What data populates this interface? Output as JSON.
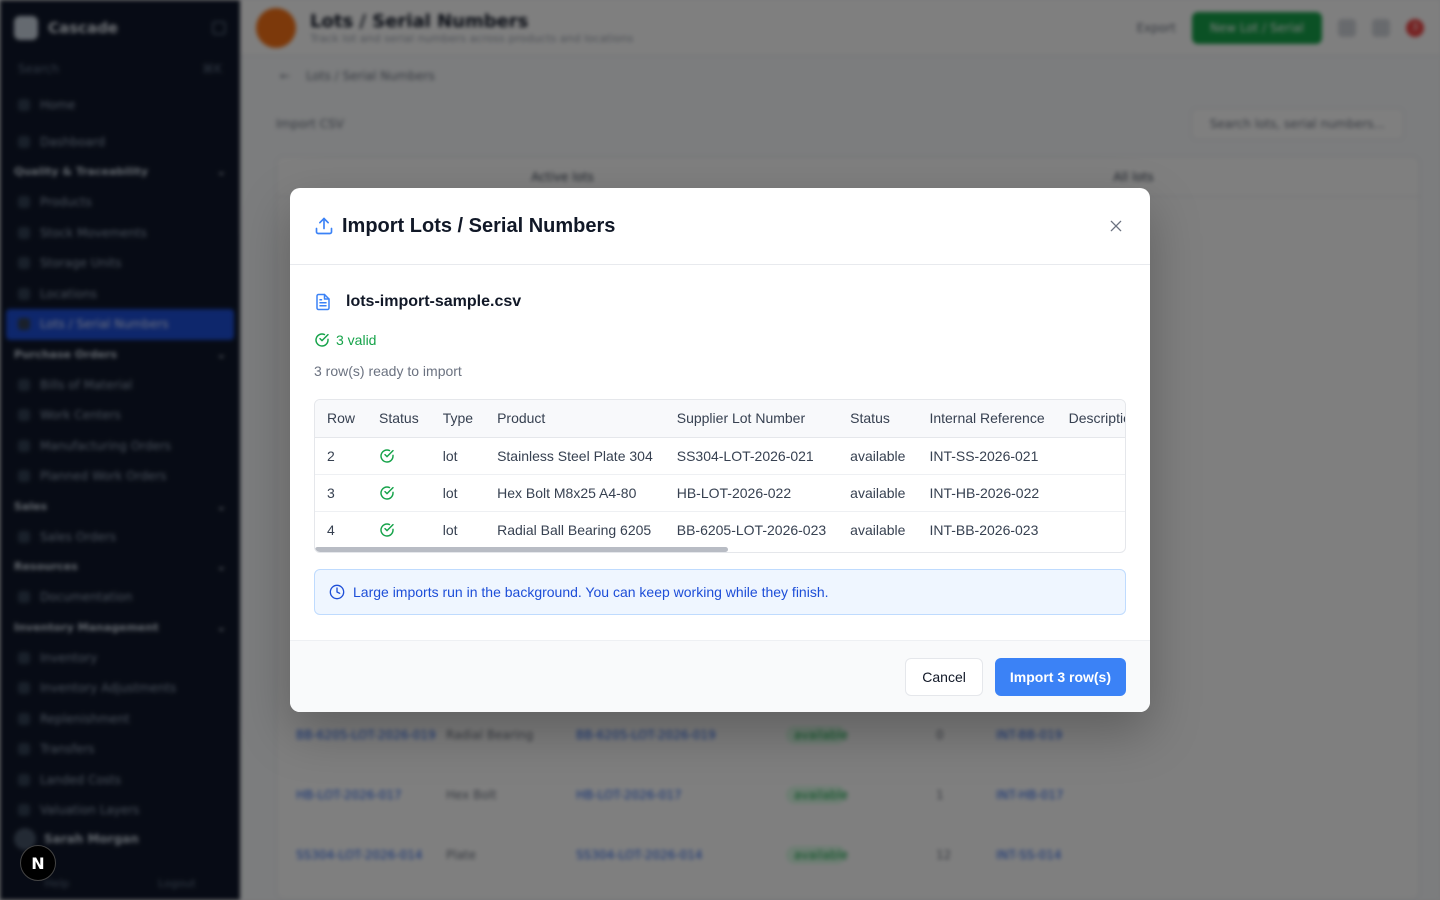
{
  "background": {
    "sidebar": {
      "app_name": "Cascade",
      "search_label": "Search",
      "search_shortcut": "⌘K",
      "top_item": "Home",
      "items": [
        {
          "type": "item",
          "label": "Dashboard"
        },
        {
          "type": "group",
          "label": "Quality & Traceability"
        },
        {
          "type": "item",
          "label": "Products"
        },
        {
          "type": "item",
          "label": "Stock Movements"
        },
        {
          "type": "item",
          "label": "Storage Units"
        },
        {
          "type": "item",
          "label": "Locations"
        },
        {
          "type": "active",
          "label": "Lots / Serial Numbers"
        },
        {
          "type": "group",
          "label": "Purchase Orders"
        },
        {
          "type": "item",
          "label": "Bills of Material"
        },
        {
          "type": "item",
          "label": "Work Centers"
        },
        {
          "type": "item",
          "label": "Manufacturing Orders"
        },
        {
          "type": "item",
          "label": "Planned Work Orders"
        },
        {
          "type": "group",
          "label": "Sales"
        },
        {
          "type": "item",
          "label": "Sales Orders"
        },
        {
          "type": "group",
          "label": "Resources"
        },
        {
          "type": "item",
          "label": "Documentation"
        },
        {
          "type": "group",
          "label": "Inventory Management"
        },
        {
          "type": "item",
          "label": "Inventory"
        },
        {
          "type": "item",
          "label": "Inventory Adjustments"
        },
        {
          "type": "item",
          "label": "Replenishment"
        },
        {
          "type": "item",
          "label": "Transfers"
        },
        {
          "type": "item",
          "label": "Landed Costs"
        },
        {
          "type": "item",
          "label": "Valuation Layers"
        }
      ],
      "user_name": "Sarah Morgan",
      "bottom_left": "Help",
      "bottom_right": "Logout"
    },
    "topbar": {
      "title": "Lots / Serial Numbers",
      "subtitle": "Track lot and serial numbers across products and locations",
      "ghost_button": "Export",
      "green_button": "New Lot / Serial",
      "notification_count": "3"
    },
    "breadcrumb": "Lots / Serial Numbers",
    "toolbar": {
      "left": "Import CSV",
      "right": "Search lots, serial numbers..."
    },
    "tabs": [
      "Active lots",
      "All lots"
    ],
    "rows": [
      {
        "a": "BB-6205-LOT-2026-019",
        "b": "Radial Bearing",
        "c": "BB-6205-LOT-2026-019",
        "d": "available",
        "e": "0",
        "f": "INT-BB-019"
      },
      {
        "a": "HB-LOT-2026-017",
        "b": "Hex Bolt",
        "c": "HB-LOT-2026-017",
        "d": "available",
        "e": "1",
        "f": "INT-HB-017"
      },
      {
        "a": "SS304-LOT-2026-014",
        "b": "Plate",
        "c": "SS304-LOT-2026-014",
        "d": "available",
        "e": "12",
        "f": "INT-SS-014"
      }
    ]
  },
  "modal": {
    "title": "Import Lots / Serial Numbers",
    "file_name": "lots-import-sample.csv",
    "valid_label": "3 valid",
    "ready_text": "3 row(s) ready to import",
    "table": {
      "headers": [
        "Row",
        "Status",
        "Type",
        "Product",
        "Supplier Lot Number",
        "Status",
        "Internal Reference",
        "Description"
      ],
      "rows": [
        {
          "row": "2",
          "status_icon": "check-circle-icon",
          "type": "lot",
          "product": "Stainless Steel Plate 304",
          "supplier_lot": "SS304-LOT-2026-021",
          "lot_status": "available",
          "internal_ref": "INT-SS-2026-021",
          "description": ""
        },
        {
          "row": "3",
          "status_icon": "check-circle-icon",
          "type": "lot",
          "product": "Hex Bolt M8x25 A4-80",
          "supplier_lot": "HB-LOT-2026-022",
          "lot_status": "available",
          "internal_ref": "INT-HB-2026-022",
          "description": ""
        },
        {
          "row": "4",
          "status_icon": "check-circle-icon",
          "type": "lot",
          "product": "Radial Ball Bearing 6205",
          "supplier_lot": "BB-6205-LOT-2026-023",
          "lot_status": "available",
          "internal_ref": "INT-BB-2026-023",
          "description": ""
        }
      ]
    },
    "info_text": "Large imports run in the background. You can keep working while they finish.",
    "cancel_label": "Cancel",
    "import_label": "Import 3 row(s)"
  },
  "dev_badge": "N",
  "colors": {
    "primary": "#3b82f6",
    "success": "#16a34a",
    "info_bg": "#eff6ff",
    "info_text": "#1d4ed8",
    "sidebar_bg": "#0f172a"
  }
}
